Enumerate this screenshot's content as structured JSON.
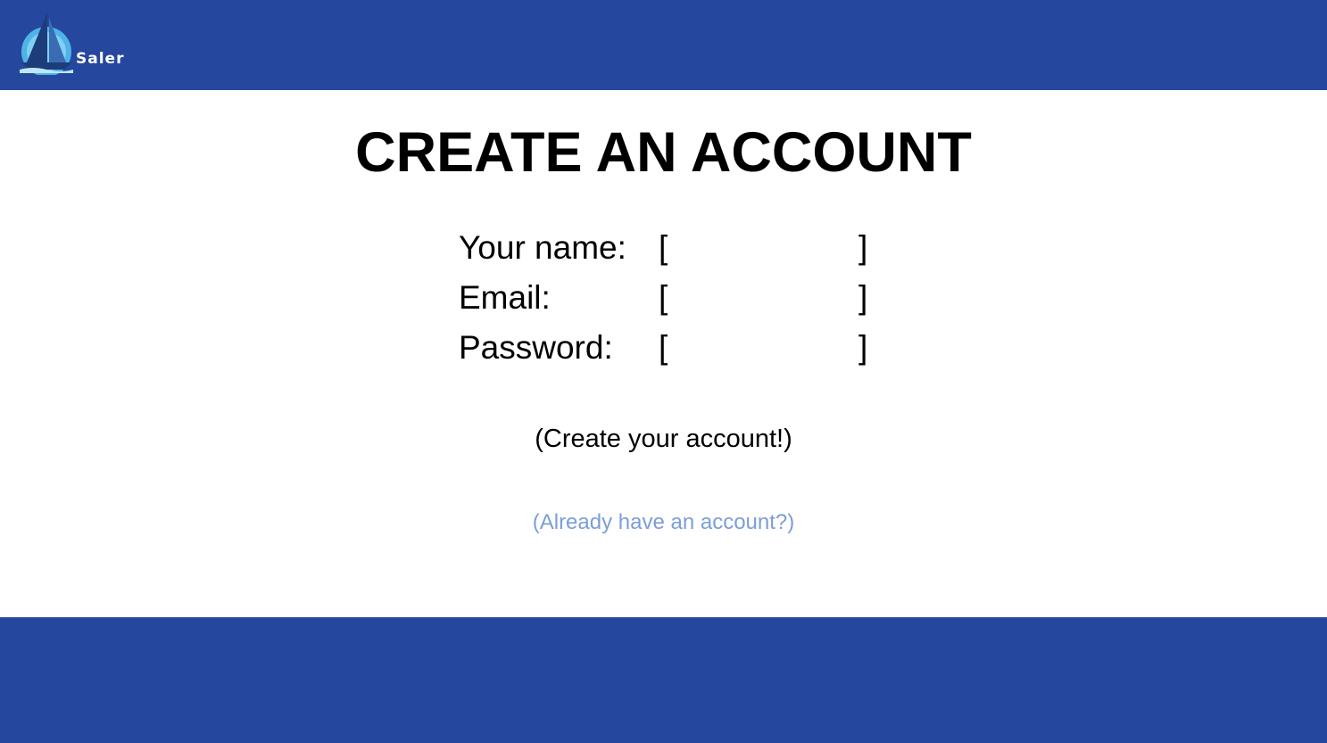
{
  "header": {
    "logo_text": "Saler",
    "bg_color": "#25479e"
  },
  "page": {
    "title": "CREATE AN ACCOUNT"
  },
  "form": {
    "fields": [
      {
        "label": "Your name:",
        "value": "",
        "placeholder": ""
      },
      {
        "label": "Email:",
        "value": "",
        "placeholder": ""
      },
      {
        "label": "Password:",
        "value": "",
        "placeholder": ""
      }
    ],
    "bracket_open": "[",
    "bracket_close": "]",
    "submit_label": "(Create your account!)",
    "login_link_label": "(Already have an account?)"
  },
  "colors": {
    "brand": "#25479e",
    "link": "#7c9ed6"
  }
}
